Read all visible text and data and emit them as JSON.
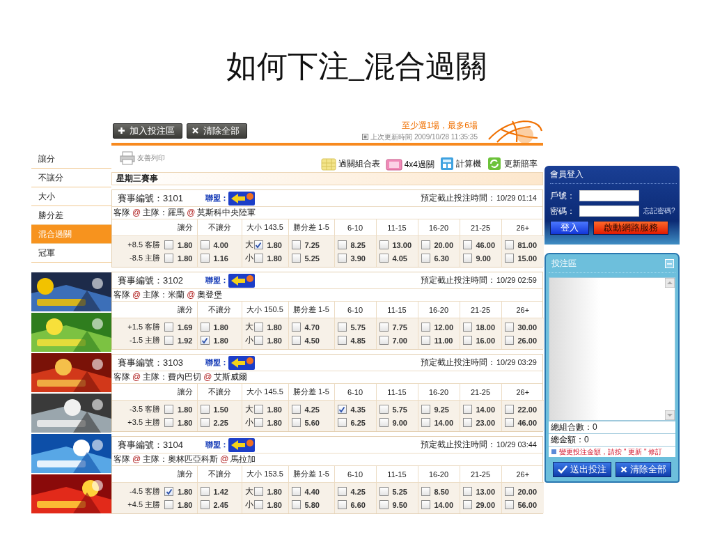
{
  "slide_title": "如何下注_混合過關",
  "top_buttons": [
    {
      "label": "加入投注區",
      "kind": "add"
    },
    {
      "label": "清除全部",
      "kind": "clear"
    }
  ],
  "notice": "至少選1場，最多6場",
  "last_update": "上次更新時間 2009/10/28 11:35:35",
  "menu": [
    {
      "label": "讓分",
      "selected": false
    },
    {
      "label": "不讓分",
      "selected": false
    },
    {
      "label": "大小",
      "selected": false
    },
    {
      "label": "勝分差",
      "selected": false
    },
    {
      "label": "混合過關",
      "selected": true
    },
    {
      "label": "冠軍",
      "selected": false
    }
  ],
  "tools": [
    {
      "label": "友善列印",
      "kind": "print"
    },
    {
      "label": "過關組合表",
      "kind": "table"
    },
    {
      "label": "4x4過關",
      "kind": "grid"
    },
    {
      "label": "計算機",
      "kind": "calculator"
    },
    {
      "label": "更新賠率",
      "kind": "refresh"
    }
  ],
  "day_heading": "星期三賽事",
  "matches": [
    {
      "number": "賽事編號：3101",
      "league": "聯盟：",
      "deadline_label": "預定截止投注時間：",
      "deadline": "10/29 01:14",
      "matchup": [
        {
          "text": "客隊",
          "kind": "label"
        },
        {
          "text": "@",
          "kind": "at"
        },
        {
          "text": "主隊：羅馬",
          "kind": "label"
        },
        {
          "text": "@",
          "kind": "at"
        },
        {
          "text": "莫斯科中央陸軍",
          "kind": "label"
        }
      ],
      "columns": [
        "讓分",
        "不讓分",
        "大小 143.5",
        "勝分差 1-5",
        "6-10",
        "11-15",
        "16-20",
        "21-25",
        "26+"
      ],
      "rows": [
        {
          "label": "+8.5 客勝",
          "cells": [
            {
              "odds": "1.80",
              "checked": false
            },
            {
              "odds": "4.00",
              "checked": false
            },
            {
              "side": "大",
              "odds": "1.80",
              "checked": true
            },
            {
              "odds": "7.25",
              "checked": false
            },
            {
              "odds": "8.25",
              "checked": false
            },
            {
              "odds": "13.00",
              "checked": false
            },
            {
              "odds": "20.00",
              "checked": false
            },
            {
              "odds": "46.00",
              "checked": false
            },
            {
              "odds": "81.00",
              "checked": false
            }
          ]
        },
        {
          "label": "-8.5 主勝",
          "cells": [
            {
              "odds": "1.80",
              "checked": false
            },
            {
              "odds": "1.16",
              "checked": false
            },
            {
              "side": "小",
              "odds": "1.80",
              "checked": false
            },
            {
              "odds": "5.25",
              "checked": false
            },
            {
              "odds": "3.90",
              "checked": false
            },
            {
              "odds": "4.05",
              "checked": false
            },
            {
              "odds": "6.30",
              "checked": false
            },
            {
              "odds": "9.00",
              "checked": false
            },
            {
              "odds": "15.00",
              "checked": false
            }
          ]
        }
      ]
    },
    {
      "number": "賽事編號：3102",
      "league": "聯盟：",
      "deadline_label": "預定截止投注時間：",
      "deadline": "10/29 02:59",
      "matchup": [
        {
          "text": "客隊",
          "kind": "label"
        },
        {
          "text": "@",
          "kind": "at"
        },
        {
          "text": "主隊：米蘭",
          "kind": "label"
        },
        {
          "text": "@",
          "kind": "at"
        },
        {
          "text": "奧登堡",
          "kind": "label"
        }
      ],
      "columns": [
        "讓分",
        "不讓分",
        "大小 150.5",
        "勝分差 1-5",
        "6-10",
        "11-15",
        "16-20",
        "21-25",
        "26+"
      ],
      "rows": [
        {
          "label": "+1.5 客勝",
          "cells": [
            {
              "odds": "1.69",
              "checked": false
            },
            {
              "odds": "1.80",
              "checked": false
            },
            {
              "side": "大",
              "odds": "1.80",
              "checked": false
            },
            {
              "odds": "4.70",
              "checked": false
            },
            {
              "odds": "5.75",
              "checked": false
            },
            {
              "odds": "7.75",
              "checked": false
            },
            {
              "odds": "12.00",
              "checked": false
            },
            {
              "odds": "18.00",
              "checked": false
            },
            {
              "odds": "30.00",
              "checked": false
            }
          ]
        },
        {
          "label": "-1.5 主勝",
          "cells": [
            {
              "odds": "1.92",
              "checked": false
            },
            {
              "odds": "1.80",
              "checked": true
            },
            {
              "side": "小",
              "odds": "1.80",
              "checked": false
            },
            {
              "odds": "4.50",
              "checked": false
            },
            {
              "odds": "4.85",
              "checked": false
            },
            {
              "odds": "7.00",
              "checked": false
            },
            {
              "odds": "11.00",
              "checked": false
            },
            {
              "odds": "16.00",
              "checked": false
            },
            {
              "odds": "26.00",
              "checked": false
            }
          ]
        }
      ]
    },
    {
      "number": "賽事編號：3103",
      "league": "聯盟：",
      "deadline_label": "預定截止投注時間：",
      "deadline": "10/29 03:29",
      "matchup": [
        {
          "text": "客隊",
          "kind": "label"
        },
        {
          "text": "@",
          "kind": "at"
        },
        {
          "text": "主隊：費內巴切",
          "kind": "label"
        },
        {
          "text": "@",
          "kind": "at"
        },
        {
          "text": "艾斯威爾",
          "kind": "label"
        }
      ],
      "columns": [
        "讓分",
        "不讓分",
        "大小 145.5",
        "勝分差 1-5",
        "6-10",
        "11-15",
        "16-20",
        "21-25",
        "26+"
      ],
      "rows": [
        {
          "label": "-3.5 客勝",
          "cells": [
            {
              "odds": "1.80",
              "checked": false
            },
            {
              "odds": "1.50",
              "checked": false
            },
            {
              "side": "大",
              "odds": "1.80",
              "checked": false
            },
            {
              "odds": "4.25",
              "checked": false
            },
            {
              "odds": "4.35",
              "checked": true
            },
            {
              "odds": "5.75",
              "checked": false
            },
            {
              "odds": "9.25",
              "checked": false
            },
            {
              "odds": "14.00",
              "checked": false
            },
            {
              "odds": "22.00",
              "checked": false
            }
          ]
        },
        {
          "label": "+3.5 主勝",
          "cells": [
            {
              "odds": "1.80",
              "checked": false
            },
            {
              "odds": "2.25",
              "checked": false
            },
            {
              "side": "小",
              "odds": "1.80",
              "checked": false
            },
            {
              "odds": "5.60",
              "checked": false
            },
            {
              "odds": "6.25",
              "checked": false
            },
            {
              "odds": "9.00",
              "checked": false
            },
            {
              "odds": "14.00",
              "checked": false
            },
            {
              "odds": "23.00",
              "checked": false
            },
            {
              "odds": "46.00",
              "checked": false
            }
          ]
        }
      ]
    },
    {
      "number": "賽事編號：3104",
      "league": "聯盟：",
      "deadline_label": "預定截止投注時間：",
      "deadline": "10/29 03:44",
      "matchup": [
        {
          "text": "客隊",
          "kind": "label"
        },
        {
          "text": "@",
          "kind": "at"
        },
        {
          "text": "主隊：奧林匹亞科斯",
          "kind": "label"
        },
        {
          "text": "@",
          "kind": "at"
        },
        {
          "text": "馬拉加",
          "kind": "label"
        }
      ],
      "columns": [
        "讓分",
        "不讓分",
        "大小 153.5",
        "勝分差 1-5",
        "6-10",
        "11-15",
        "16-20",
        "21-25",
        "26+"
      ],
      "rows": [
        {
          "label": "-4.5 客勝",
          "cells": [
            {
              "odds": "1.80",
              "checked": true
            },
            {
              "odds": "1.42",
              "checked": false
            },
            {
              "side": "大",
              "odds": "1.80",
              "checked": false
            },
            {
              "odds": "4.40",
              "checked": false
            },
            {
              "odds": "4.25",
              "checked": false
            },
            {
              "odds": "5.25",
              "checked": false
            },
            {
              "odds": "8.50",
              "checked": false
            },
            {
              "odds": "13.00",
              "checked": false
            },
            {
              "odds": "20.00",
              "checked": false
            }
          ]
        },
        {
          "label": "+4.5 主勝",
          "cells": [
            {
              "odds": "1.80",
              "checked": false
            },
            {
              "odds": "2.45",
              "checked": false
            },
            {
              "side": "小",
              "odds": "1.80",
              "checked": false
            },
            {
              "odds": "5.80",
              "checked": false
            },
            {
              "odds": "6.60",
              "checked": false
            },
            {
              "odds": "9.50",
              "checked": false
            },
            {
              "odds": "14.00",
              "checked": false
            },
            {
              "odds": "29.00",
              "checked": false
            },
            {
              "odds": "56.00",
              "checked": false
            }
          ]
        }
      ]
    }
  ],
  "login": {
    "title": "會員登入",
    "account_label": "戶號：",
    "password_label": "密碼：",
    "forgot": "忘記密碼?",
    "login_button": "登入",
    "service_button": "啟動網路服務"
  },
  "bet_slip": {
    "title": "投注區",
    "total_combos": "總組合數：0",
    "total_amount": "總金額：0",
    "note": "變更投注金額，請按 \" 更新 \" 修訂",
    "buttons": [
      {
        "label": "送出投注",
        "kind": "submit"
      },
      {
        "label": "清除全部",
        "kind": "clear"
      }
    ]
  }
}
